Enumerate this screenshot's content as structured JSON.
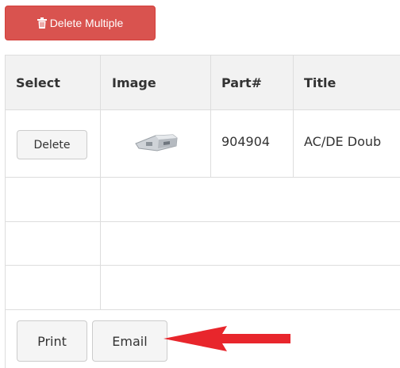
{
  "toolbar": {
    "delete_multiple_label": "Delete Multiple"
  },
  "table": {
    "headers": [
      "Select",
      "Image",
      "Part#",
      "Title"
    ],
    "rows": [
      {
        "delete_label": "Delete",
        "image_icon": "auto-part-thumbnail",
        "part_number": "904904",
        "title": "AC/DE Doub"
      }
    ]
  },
  "footer": {
    "print_label": "Print",
    "email_label": "Email"
  },
  "colors": {
    "danger": "#d9534f",
    "annotation_arrow": "#e8262c",
    "header_bg": "#f2f2f2",
    "border": "#dddddd"
  },
  "icons": {
    "delete_multiple": "trash-icon",
    "annotation": "arrow-left-icon"
  }
}
